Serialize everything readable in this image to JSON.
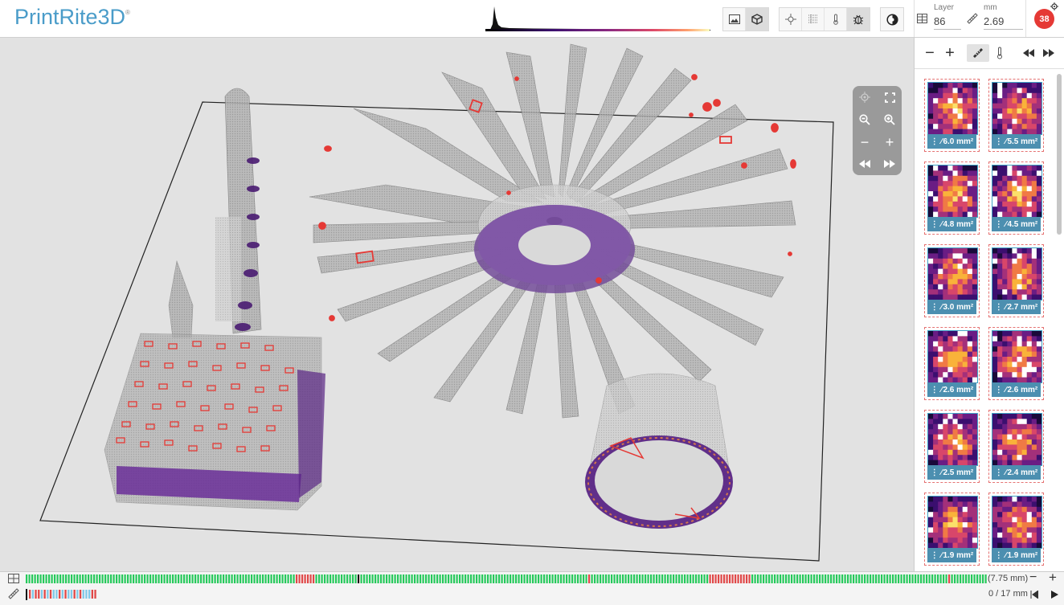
{
  "app": {
    "name": "PrintRite3D",
    "trademark": "®"
  },
  "header": {
    "view_buttons": [
      {
        "name": "image-view-button",
        "icon": "image-icon",
        "active": false
      },
      {
        "name": "3d-view-button",
        "icon": "cube-icon",
        "active": true
      }
    ],
    "tool_buttons": [
      {
        "name": "crosshair-button",
        "icon": "crosshair-icon",
        "active": false
      },
      {
        "name": "layers-grid-button",
        "icon": "grid-icon",
        "active": false
      },
      {
        "name": "temperature-button",
        "icon": "thermometer-icon",
        "active": false
      },
      {
        "name": "bug-button",
        "icon": "bug-icon",
        "active": true
      }
    ],
    "layer": {
      "label": "Layer",
      "value": "86"
    },
    "mm": {
      "label": "mm",
      "value": "2.69"
    },
    "alert_count": "38"
  },
  "right_panel": {
    "toolbar": [
      {
        "name": "zoom-out-panel-button",
        "icon": "minus-icon",
        "glyph": "−"
      },
      {
        "name": "zoom-in-panel-button",
        "icon": "plus-icon",
        "glyph": "+"
      },
      {
        "name": "ruler-toggle-button",
        "icon": "ruler-icon",
        "glyph": "📏",
        "active": true
      },
      {
        "name": "thermometer-toggle-button",
        "icon": "thermometer-icon",
        "glyph": "🌡"
      },
      {
        "name": "previous-button",
        "icon": "rewind-icon",
        "glyph": "⏪"
      },
      {
        "name": "next-button",
        "icon": "fast-forward-icon",
        "glyph": "⏩"
      }
    ],
    "thumbnails": [
      {
        "area": "6.0 mm²"
      },
      {
        "area": "5.5 mm²"
      },
      {
        "area": "4.8 mm²"
      },
      {
        "area": "4.5 mm²"
      },
      {
        "area": "3.0 mm²"
      },
      {
        "area": "2.7 mm²"
      },
      {
        "area": "2.6 mm²"
      },
      {
        "area": "2.6 mm²"
      },
      {
        "area": "2.5 mm²"
      },
      {
        "area": "2.4 mm²"
      },
      {
        "area": "1.9 mm²"
      },
      {
        "area": "1.9 mm²"
      }
    ]
  },
  "bottom": {
    "track_value": "(7.75 mm)",
    "position_text": "0 / 17 mm"
  },
  "colors": {
    "accent": "#4a9cc9",
    "alert": "#e53935",
    "good": "#26c95b",
    "bad": "#e04848",
    "thumb_caption": "#4c8fb0"
  }
}
